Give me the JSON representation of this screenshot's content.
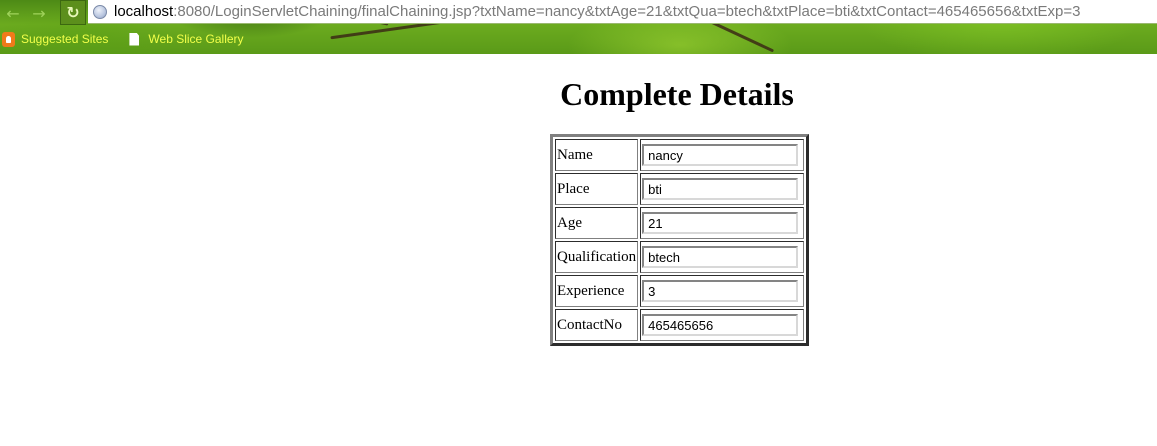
{
  "browser": {
    "url_host": "localhost",
    "url_rest": ":8080/LoginServletChaining/finalChaining.jsp?txtName=nancy&txtAge=21&txtQua=btech&txtPlace=bti&txtContact=465465656&txtExp=3",
    "bookmarks": [
      {
        "label": "Suggested Sites"
      },
      {
        "label": "Web Slice Gallery"
      }
    ]
  },
  "page": {
    "title": "Complete Details",
    "rows": [
      {
        "label": "Name",
        "value": "nancy"
      },
      {
        "label": "Place",
        "value": "bti"
      },
      {
        "label": "Age",
        "value": "21"
      },
      {
        "label": "Qualification",
        "value": "btech"
      },
      {
        "label": "Experience",
        "value": "3"
      },
      {
        "label": "ContactNo",
        "value": "465465656"
      }
    ]
  }
}
